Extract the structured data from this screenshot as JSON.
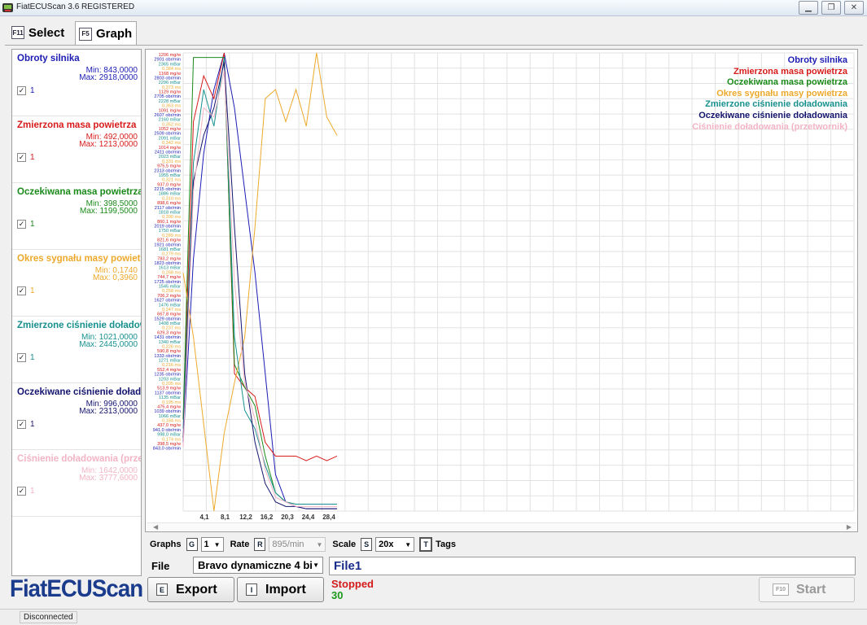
{
  "window": {
    "title": "FiatECUScan 3.6 REGISTERED"
  },
  "tabs": [
    {
      "key": "F11",
      "label": "Select"
    },
    {
      "key": "F5",
      "label": "Graph"
    }
  ],
  "signals": [
    {
      "name": "Obroty silnika",
      "min": "Min: 843,0000",
      "max": "Max: 2918,0000",
      "num": "1",
      "color": "#1c1cb4"
    },
    {
      "name": "Zmierzona masa powietrza",
      "min": "Min: 492,0000",
      "max": "Max: 1213,0000",
      "num": "1",
      "color": "#d81b1b"
    },
    {
      "name": "Oczekiwana masa powietrza",
      "min": "Min: 398,5000",
      "max": "Max: 1199,5000",
      "num": "1",
      "color": "#1a8a1a"
    },
    {
      "name": "Okres sygnału masy powietrz",
      "min": "Min: 0,1740",
      "max": "Max: 0,3960",
      "num": "1",
      "color": "#eda92c"
    },
    {
      "name": "Zmierzone ciśnienie doładow",
      "min": "Min: 1021,0000",
      "max": "Max: 2445,0000",
      "num": "1",
      "color": "#17908f"
    },
    {
      "name": "Oczekiwane ciśnienie doładow",
      "min": "Min: 996,0000",
      "max": "Max: 2313,0000",
      "num": "1",
      "color": "#14146e"
    },
    {
      "name": "Ciśnienie doładowania (przet",
      "min": "Min: 1642,0000",
      "max": "Max: 3777,6000",
      "num": "1",
      "color": "#f2b4c4"
    }
  ],
  "legend": [
    {
      "label": "Obroty silnika",
      "color": "#1c1cb4"
    },
    {
      "label": "Zmierzona masa powietrza",
      "color": "#d81b1b"
    },
    {
      "label": "Oczekiwana masa powietrza",
      "color": "#1a8a1a"
    },
    {
      "label": "Okres sygnału masy powietrza",
      "color": "#eda92c"
    },
    {
      "label": "Zmierzone ciśnienie doładowania",
      "color": "#17908f"
    },
    {
      "label": "Oczekiwane ciśnienie doładowania",
      "color": "#14146e"
    },
    {
      "label": "Ciśnienie doładowania (przetwornik)",
      "color": "#f2b4c4"
    }
  ],
  "axis": {
    "x_ticks": [
      "4,1",
      "8,1",
      "12,2",
      "16,2",
      "20,3",
      "24,4",
      "28,4"
    ],
    "y_labels_top": [
      "1206 mg/w",
      "2901 obr/min",
      "2365 mBar",
      "0,384 ms",
      "1168 mg/w",
      "2803 obr/min",
      "2296 mBar",
      "0,373 ms",
      "1129 mg/w",
      "2705 obr/min",
      "2228 mBar",
      "0,363 ms",
      "1091 mg/w",
      "2607 obr/min",
      "2160 mBar",
      "0,352 ms",
      "1052 mg/w",
      "2509 obr/min",
      "2091 mBar",
      "0,342 ms",
      "1014 mg/w",
      "2411 obr/min",
      "2023 mBar",
      "0,331 ms",
      "975,5 mg/w",
      "2313 obr/min",
      "1955 mBar",
      "0,321 ms",
      "937,0 mg/w",
      "2215 obr/min",
      "1886 mBar",
      "0,310 ms",
      "898,6 mg/w",
      "2117 obr/min",
      "1818 mBar",
      "0,300 ms",
      "860,1 mg/w",
      "2019 obr/min",
      "1750 mBar",
      "0,289 ms",
      "821,6 mg/w",
      "1921 obr/min",
      "1681 mBar",
      "0,279 ms",
      "783,2 mg/w",
      "1823 obr/min",
      "1613 mBar",
      "0,268 ms",
      "744,7 mg/w",
      "1725 obr/min",
      "1545 mBar",
      "0,258 ms",
      "706,2 mg/w",
      "1627 obr/min",
      "1476 mBar",
      "0,247 ms",
      "667,8 mg/w",
      "1529 obr/min",
      "1408 mBar",
      "0,237 ms",
      "629,3 mg/w",
      "1431 obr/min",
      "1340 mBar",
      "0,226 ms",
      "590,8 mg/w",
      "1333 obr/min",
      "1271 mBar",
      "0,216 ms",
      "552,4 mg/w",
      "1235 obr/min",
      "1203 mBar",
      "0,205 ms",
      "513,9 mg/w",
      "1137 obr/min",
      "1135 mBar",
      "0,195 ms",
      "475,4 mg/w",
      "1039 obr/min",
      "1066 mBar",
      "0,184 ms",
      "437,0 mg/w",
      "941,0 obr/min",
      "998,0 mBar",
      "0,174 ms",
      "398,5 mg/w",
      "843,0 obr/min"
    ]
  },
  "controls": {
    "graphs_label": "Graphs",
    "graphs_key": "G",
    "graphs_value": "1",
    "rate_label": "Rate",
    "rate_key": "R",
    "rate_value": "895/min",
    "scale_label": "Scale",
    "scale_key": "S",
    "scale_value": "20x",
    "tags_key": "T",
    "tags_label": "Tags"
  },
  "file": {
    "label": "File",
    "selected": "Bravo dynamiczne 4 bi",
    "name": "File1",
    "export_key": "E",
    "export_label": "Export",
    "import_key": "I",
    "import_label": "Import",
    "status": "Stopped",
    "count": "30",
    "start_key": "F10",
    "start_label": "Start"
  },
  "logo": "FiatECUScan",
  "statusbar": {
    "connection": "Disconnected"
  }
}
